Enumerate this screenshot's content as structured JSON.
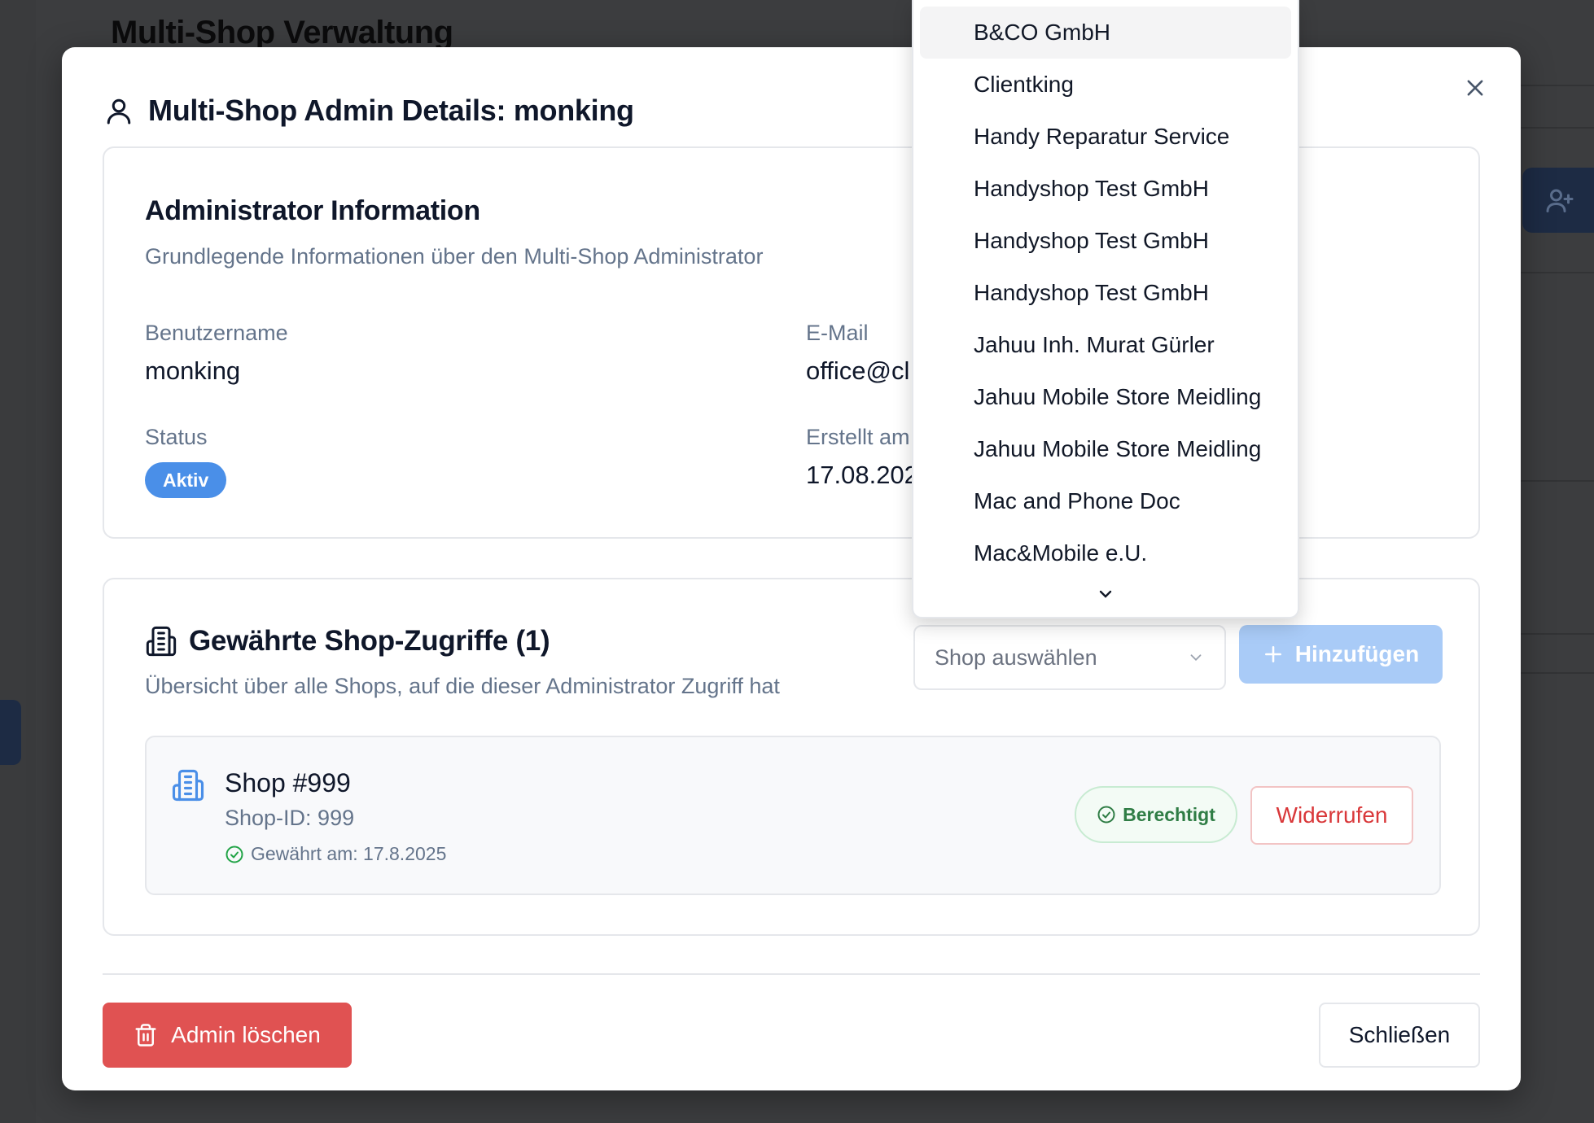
{
  "background": {
    "page_title": "Multi-Shop Verwaltung"
  },
  "modal": {
    "title": "Multi-Shop Admin Details: monking",
    "info_card": {
      "title": "Administrator Information",
      "subtitle": "Grundlegende Informationen über den Multi-Shop Administrator",
      "username_label": "Benutzername",
      "username_value": "monking",
      "email_label": "E-Mail",
      "email_value": "office@cl",
      "status_label": "Status",
      "status_value": "Aktiv",
      "created_label": "Erstellt am",
      "created_value": "17.08.202"
    },
    "shops_card": {
      "title": "Gewährte Shop-Zugriffe (1)",
      "subtitle": "Übersicht über alle Shops, auf die dieser Administrator Zugriff hat",
      "select_placeholder": "Shop auswählen",
      "add_label": "Hinzufügen",
      "shops": [
        {
          "name": "Shop #999",
          "id_text": "Shop-ID: 999",
          "granted_text": "Gewährt am: 17.8.2025",
          "badge": "Berechtigt",
          "revoke_label": "Widerrufen"
        }
      ]
    },
    "footer": {
      "delete_label": "Admin löschen",
      "close_label": "Schließen"
    }
  },
  "dropdown": {
    "options": [
      "B&CO GmbH",
      "Clientking",
      "Handy Reparatur Service",
      "Handyshop Test GmbH",
      "Handyshop Test GmbH",
      "Handyshop Test GmbH",
      "Jahuu Inh. Murat Gürler",
      "Jahuu Mobile Store Meidling",
      "Jahuu Mobile Store Meidling",
      "Mac and Phone Doc",
      "Mac&Mobile e.U."
    ],
    "highlighted_index": 0
  },
  "colors": {
    "primary": "#4a8fe8",
    "danger": "#e05252",
    "success": "#2f7d45"
  }
}
